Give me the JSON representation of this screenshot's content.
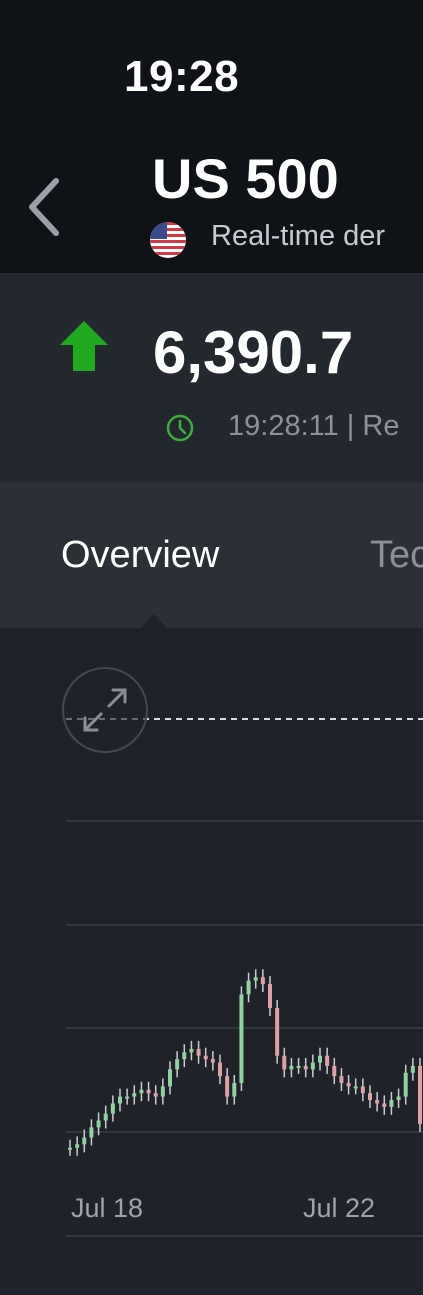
{
  "status_bar": {
    "time": "19:28"
  },
  "header": {
    "title": "US 500",
    "subtitle": "Real-time der",
    "flag_icon": "us-flag-icon"
  },
  "quote": {
    "price": "6,390.7",
    "direction": "up",
    "timestamp": "19:28:11 | Re",
    "up_color": "#1faa1f",
    "clock_color": "#3dad3d"
  },
  "tabs": [
    {
      "label": "Overview",
      "active": true
    },
    {
      "label": "Tec",
      "active": false
    }
  ],
  "chart_data": {
    "type": "candlestick",
    "x_tick_labels": [
      "Jul 18",
      "Jul 22"
    ],
    "series": [
      {
        "values": [
          3,
          4,
          6,
          9,
          11,
          13,
          16,
          18,
          18,
          19,
          20,
          19,
          18,
          21,
          26,
          29,
          31,
          32,
          30,
          29,
          28,
          24,
          18,
          22,
          48,
          52,
          53,
          51,
          44,
          30,
          26,
          27,
          27,
          26,
          28,
          30,
          27,
          24,
          22,
          21,
          21,
          19,
          17,
          16,
          15,
          17,
          18,
          25,
          27,
          10
        ]
      }
    ],
    "ylim": [
      0,
      100
    ],
    "grid": true,
    "candle_color": "#c9ccd0",
    "up_tint": "#8fd3a0",
    "down_tint": "#e0a0a6"
  },
  "expand_icon": "expand-icon"
}
